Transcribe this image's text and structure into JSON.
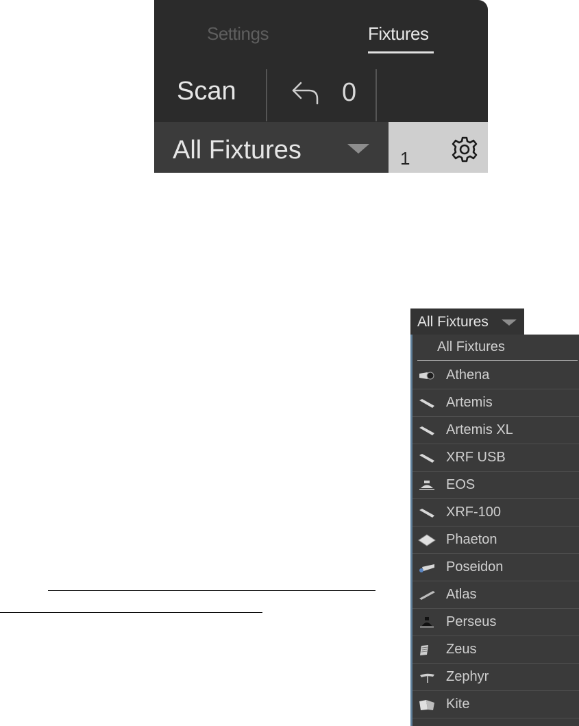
{
  "tabs": {
    "settings": "Settings",
    "fixtures": "Fixtures",
    "active": "Fixtures"
  },
  "toolbar": {
    "scan_label": "Scan",
    "undo_count": "0"
  },
  "filter": {
    "selected": "All Fixtures",
    "count": "1"
  },
  "dropdown": {
    "selected": "All Fixtures",
    "all_option": "All Fixtures",
    "items": [
      {
        "label": "Athena",
        "icon": "athena-fixture-icon"
      },
      {
        "label": "Artemis",
        "icon": "artemis-fixture-icon"
      },
      {
        "label": "Artemis XL",
        "icon": "artemis-xl-fixture-icon"
      },
      {
        "label": "XRF USB",
        "icon": "xrf-usb-fixture-icon"
      },
      {
        "label": "EOS",
        "icon": "eos-fixture-icon"
      },
      {
        "label": "XRF-100",
        "icon": "xrf-100-fixture-icon"
      },
      {
        "label": "Phaeton",
        "icon": "phaeton-fixture-icon"
      },
      {
        "label": "Poseidon",
        "icon": "poseidon-fixture-icon"
      },
      {
        "label": "Atlas",
        "icon": "atlas-fixture-icon"
      },
      {
        "label": "Perseus",
        "icon": "perseus-fixture-icon"
      },
      {
        "label": "Zeus",
        "icon": "zeus-fixture-icon"
      },
      {
        "label": "Zephyr",
        "icon": "zephyr-fixture-icon"
      },
      {
        "label": "Kite",
        "icon": "kite-fixture-icon"
      }
    ]
  },
  "colors": {
    "panel_bg": "#2b2b2b",
    "filter_bg": "#3b3b3b",
    "count_bg": "#cfcfcf",
    "list_accent": "#5f7f9a"
  }
}
